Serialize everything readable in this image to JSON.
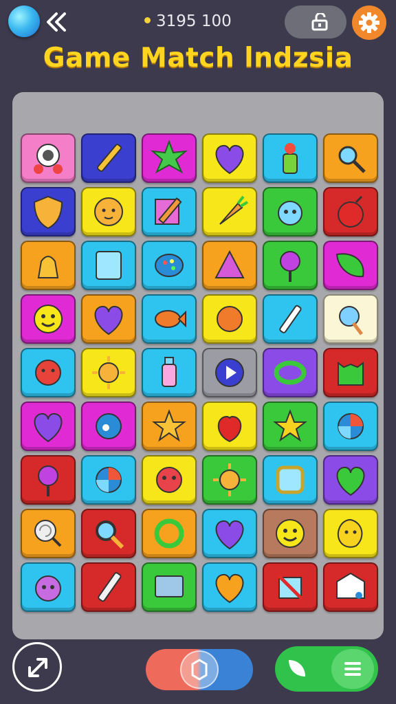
{
  "header": {
    "score_text": "3195 100",
    "title": "Game Match lndzsia"
  },
  "icons": {
    "orb": "planet-orb-icon",
    "back": "double-chevron-left-icon",
    "lock": "unlock-icon",
    "settings": "gear-icon",
    "share": "expand-arrow-icon",
    "slider_knob": "hexagon-icon",
    "leaf": "leaf-icon",
    "menu": "hamburger-menu-icon"
  },
  "colors": {
    "background": "#3c3a4c",
    "title": "#ffd51f",
    "board": "#a8a8ac",
    "settings_button": "#f1882b",
    "green_button": "#31c24b"
  },
  "board": {
    "rows": 9,
    "cols": 6,
    "tiles": [
      [
        "pink",
        "eye-robot"
      ],
      [
        "navy",
        "pencil"
      ],
      [
        "magenta",
        "spiky-star"
      ],
      [
        "yellow",
        "heart"
      ],
      [
        "cyan",
        "flower-pot"
      ],
      [
        "orange",
        "magnifier-star"
      ],
      [
        "navy",
        "face-shield"
      ],
      [
        "yellow",
        "lion-face"
      ],
      [
        "cyan",
        "pencil-paper"
      ],
      [
        "yellow",
        "carrot"
      ],
      [
        "green",
        "virus"
      ],
      [
        "red",
        "bomb"
      ],
      [
        "orange",
        "bell-bird"
      ],
      [
        "cyan",
        "tablet"
      ],
      [
        "cyan",
        "palette"
      ],
      [
        "orange",
        "pyramid"
      ],
      [
        "green",
        "lollipop"
      ],
      [
        "magenta",
        "green-leaf"
      ],
      [
        "magenta",
        "smiley"
      ],
      [
        "orange",
        "heart"
      ],
      [
        "cyan",
        "fish"
      ],
      [
        "yellow",
        "face-profile"
      ],
      [
        "cyan",
        "paint-tube"
      ],
      [
        "cream",
        "ice-cream"
      ],
      [
        "cyan",
        "tomato"
      ],
      [
        "yellow",
        "sun"
      ],
      [
        "cyan",
        "spray-bottle"
      ],
      [
        "gray",
        "play-button"
      ],
      [
        "purple",
        "ring"
      ],
      [
        "red",
        "monster"
      ],
      [
        "magenta",
        "heart"
      ],
      [
        "magenta",
        "planet"
      ],
      [
        "orange",
        "star-creature"
      ],
      [
        "yellow",
        "apple"
      ],
      [
        "green",
        "star"
      ],
      [
        "cyan",
        "beach-ball"
      ],
      [
        "red",
        "lollipop"
      ],
      [
        "cyan",
        "beach-ball"
      ],
      [
        "yellow",
        "red-face"
      ],
      [
        "green",
        "sun"
      ],
      [
        "cyan",
        "mirror"
      ],
      [
        "purple",
        "green-heart"
      ],
      [
        "orange",
        "swirl-candy"
      ],
      [
        "red",
        "magnifier"
      ],
      [
        "orange",
        "green-ring"
      ],
      [
        "cyan",
        "heart"
      ],
      [
        "brown",
        "smiley"
      ],
      [
        "yellow",
        "lemon-face"
      ],
      [
        "cyan",
        "purple-monster"
      ],
      [
        "red",
        "crayon"
      ],
      [
        "green",
        "screen"
      ],
      [
        "cyan",
        "orange-heart"
      ],
      [
        "red",
        "no-pencil"
      ],
      [
        "red",
        "envelope"
      ]
    ]
  },
  "controls": {
    "share_label": "",
    "menu_label": ""
  }
}
